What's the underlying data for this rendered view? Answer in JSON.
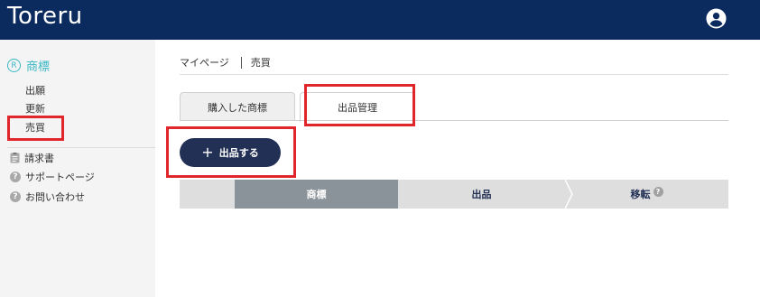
{
  "header": {
    "logo_text": "Toreru",
    "brand_color": "#0b2a5e",
    "account_icon": "account-circle-icon"
  },
  "sidebar": {
    "section_icon_text": "R",
    "section_title": "商標",
    "accent_color": "#3ab7c6",
    "sub_items": [
      {
        "label": "出願"
      },
      {
        "label": "更新"
      },
      {
        "label": "売買"
      }
    ],
    "links": [
      {
        "label": "請求書",
        "icon": "document-icon"
      },
      {
        "label": "サポートページ",
        "icon": "help-icon"
      },
      {
        "label": "お問い合わせ",
        "icon": "help-icon"
      }
    ]
  },
  "breadcrumb": {
    "items": [
      "マイページ",
      "売買"
    ]
  },
  "tabs": [
    {
      "label": "購入した商標",
      "active": false
    },
    {
      "label": "出品管理",
      "active": true
    }
  ],
  "actions": {
    "list_button_label": "出品する",
    "list_button_icon": "+"
  },
  "steps": {
    "items": [
      {
        "label": ""
      },
      {
        "label": "商標",
        "active": true
      },
      {
        "label": "出品"
      },
      {
        "label": "移転",
        "help_icon": "?"
      }
    ]
  },
  "highlight_color": "#e0262a"
}
